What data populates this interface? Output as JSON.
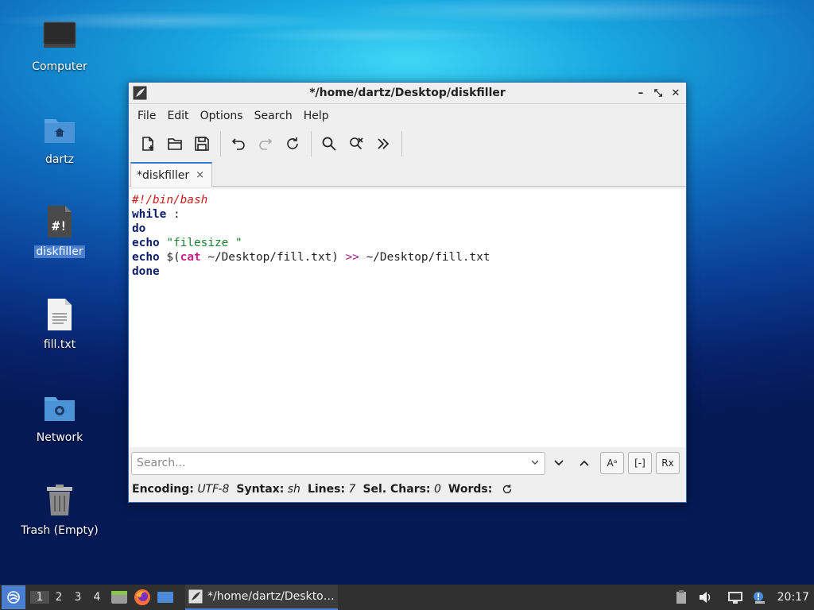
{
  "desktop": {
    "icons": [
      {
        "label": "Computer"
      },
      {
        "label": "dartz"
      },
      {
        "label": "diskfiller"
      },
      {
        "label": "fill.txt"
      },
      {
        "label": "Network"
      },
      {
        "label": "Trash (Empty)"
      }
    ]
  },
  "window": {
    "title": "*/home/dartz/Desktop/diskfiller",
    "controls": {
      "minimize": "–",
      "maximize": "⤡",
      "close": "✕"
    },
    "menu": [
      "File",
      "Edit",
      "Options",
      "Search",
      "Help"
    ],
    "toolbar": [
      "new-file",
      "open",
      "save",
      "undo",
      "redo",
      "reload",
      "find",
      "replace",
      "more"
    ],
    "tab": {
      "label": "*diskfiller",
      "close": "×"
    },
    "editor": {
      "lines": [
        "#!/bin/bash",
        "while :",
        "do",
        "echo \"filesize \"",
        "echo $(cat ~/Desktop/fill.txt) >> ~/Desktop/fill.txt",
        "done"
      ]
    },
    "search": {
      "placeholder": "Search...",
      "btn_case": "Aᵃ",
      "btn_whole": "[-]",
      "btn_regex": "Rx"
    },
    "status": {
      "encoding_label": "Encoding:",
      "encoding_value": "UTF-8",
      "syntax_label": "Syntax:",
      "syntax_value": "sh",
      "lines_label": "Lines:",
      "lines_value": "7",
      "selchars_label": "Sel. Chars:",
      "selchars_value": "0",
      "words_label": "Words:"
    }
  },
  "taskbar": {
    "workspaces": [
      "1",
      "2",
      "3",
      "4"
    ],
    "active_workspace": "1",
    "task_label": "*/home/dartz/Deskto…",
    "clock": "20:17"
  }
}
